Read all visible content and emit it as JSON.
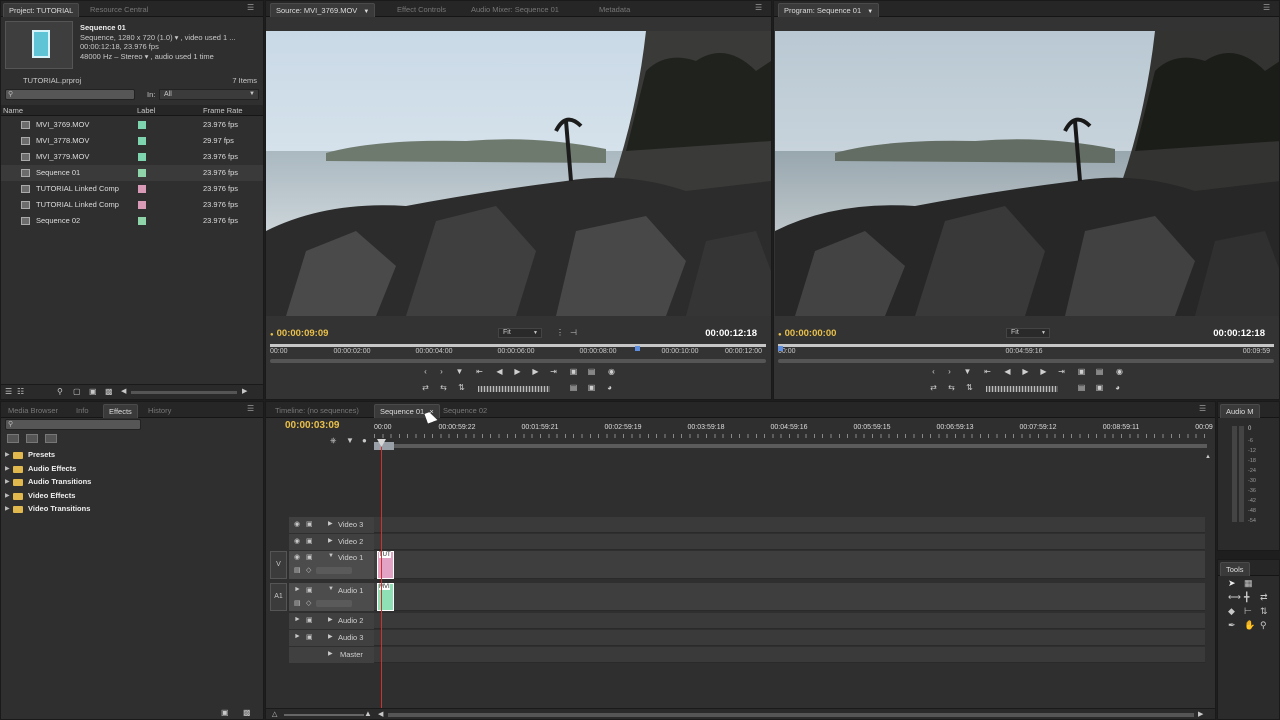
{
  "project": {
    "tab_project": "Project: TUTORIAL",
    "tab_resource": "Resource Central",
    "item_name": "Sequence 01",
    "item_line1": "Sequence, 1280 x 720 (1.0) ▾ , video used 1 ...",
    "item_line2": "00:00:12:18, 23.976 fps",
    "item_line3": "48000 Hz – Stereo ▾ , audio used 1 time",
    "file": "TUTORIAL.prproj",
    "count": "7 Items",
    "in_label": "In:",
    "in_value": "All",
    "col_name": "Name",
    "col_label": "Label",
    "col_rate": "Frame Rate",
    "items": [
      {
        "name": "MVI_3769.MOV",
        "rate": "23.976 fps",
        "color": "#7fd4b0",
        "icon": "video-clip-icon"
      },
      {
        "name": "MVI_3778.MOV",
        "rate": "29.97 fps",
        "color": "#7fd4b0",
        "icon": "video-clip-icon"
      },
      {
        "name": "MVI_3779.MOV",
        "rate": "23.976 fps",
        "color": "#7fd4b0",
        "icon": "video-clip-icon"
      },
      {
        "name": "Sequence 01",
        "rate": "23.976 fps",
        "color": "#8fd4a8",
        "icon": "sequence-icon"
      },
      {
        "name": "TUTORIAL Linked Comp",
        "rate": "23.976 fps",
        "color": "#d99ab8",
        "icon": "linked-comp-icon"
      },
      {
        "name": "TUTORIAL Linked Comp",
        "rate": "23.976 fps",
        "color": "#d99ab8",
        "icon": "linked-comp-icon"
      },
      {
        "name": "Sequence 02",
        "rate": "23.976 fps",
        "color": "#8fd4a8",
        "icon": "sequence-icon"
      }
    ]
  },
  "source": {
    "tab_source": "Source: MVI_3769.MOV",
    "tab_effects": "Effect Controls",
    "tab_mixer": "Audio Mixer: Sequence 01",
    "tab_meta": "Metadata",
    "timecode": "00:00:09:09",
    "duration": "00:00:12:18",
    "fit": "Fit",
    "ruler": [
      "00:00",
      "00:00:02:00",
      "00:00:04:00",
      "00:00:06:00",
      "00:00:08:00",
      "00:00:10:00",
      "00:00:12:00"
    ]
  },
  "program": {
    "tab": "Program: Sequence 01",
    "timecode": "00:00:00:00",
    "duration": "00:00:12:18",
    "fit": "Fit",
    "ruler": [
      "00:00",
      "00:04:59:16",
      "00:09:59"
    ]
  },
  "effects": {
    "tab_media": "Media Browser",
    "tab_info": "Info",
    "tab_effects": "Effects",
    "tab_history": "History",
    "folders": [
      "Presets",
      "Audio Effects",
      "Audio Transitions",
      "Video Effects",
      "Video Transitions"
    ]
  },
  "timeline": {
    "tab_none": "Timeline: (no sequences)",
    "tab_seq1": "Sequence 01",
    "tab_seq2": "Sequence 02",
    "timecode": "00:00:03:09",
    "ruler": [
      "00:00",
      "00:00:59:22",
      "00:01:59:21",
      "00:02:59:19",
      "00:03:59:18",
      "00:04:59:16",
      "00:05:59:15",
      "00:06:59:13",
      "00:07:59:12",
      "00:08:59:11",
      "00:09"
    ],
    "tracks": {
      "video3": "Video 3",
      "video2": "Video 2",
      "video1": "Video 1",
      "audio1": "Audio 1",
      "audio2": "Audio 2",
      "audio3": "Audio 3",
      "master": "Master"
    },
    "v_label": "V",
    "a_label": "A1",
    "clip_video": "TUT",
    "clip_audio": "MVI"
  },
  "audio_meter": {
    "tab": "Audio M",
    "top": "0",
    "ticks": [
      "-6",
      "-12",
      "-18",
      "-24",
      "-30",
      "-36",
      "-42",
      "-48",
      "-54"
    ]
  },
  "tools": {
    "tab": "Tools"
  },
  "colors": {
    "timecode": "#e9c04b",
    "playhead": "#d23030",
    "video_clip": "#e3a3c4",
    "audio_clip": "#8fe0b5"
  }
}
